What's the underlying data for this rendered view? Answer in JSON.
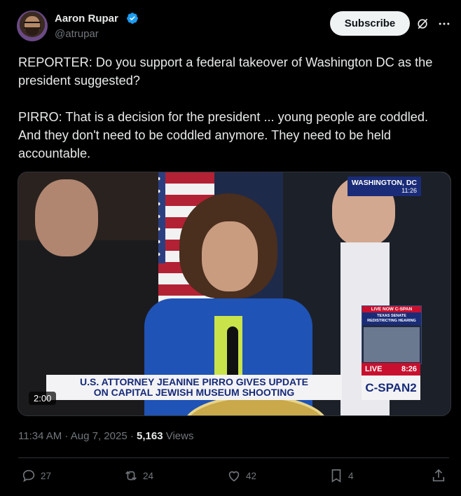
{
  "author": {
    "name": "Aaron Rupar",
    "handle": "@atrupar",
    "verified_color": "#1d9bf0"
  },
  "subscribe_label": "Subscribe",
  "tweet_text": "REPORTER: Do you support a federal takeover of Washington DC as the president suggested?\n\nPIRRO: That is a decision for the president ... young people are coddled. And they don't need to be coddled anymore. They need to be held accountable.",
  "video": {
    "location": "WASHINGTON, DC",
    "time_stamp": "11:26",
    "chyron_line1": "U.S. ATTORNEY JEANINE PIRRO GIVES UPDATE",
    "chyron_line2": "ON CAPITAL JEWISH MUSEUM SHOOTING",
    "live_now": "LIVE NOW C-SPAN",
    "live_program": "TEXAS SENATE REDISTRICTING HEARING",
    "live_label": "LIVE",
    "live_time": "8:26",
    "network": "C-SPAN2",
    "duration": "2:00"
  },
  "meta": {
    "timestamp": "11:34 AM · Aug 7, 2025 · ",
    "views_count": "5,163",
    "views_label": " Views"
  },
  "actions": {
    "replies": "27",
    "reposts": "24",
    "likes": "42",
    "bookmarks": "4"
  }
}
